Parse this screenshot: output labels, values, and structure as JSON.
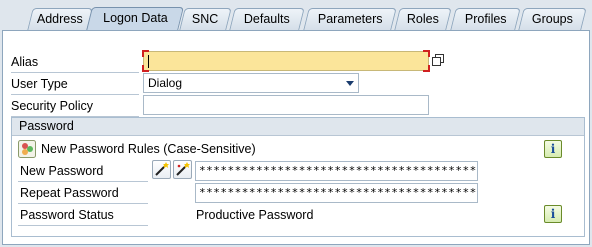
{
  "tabs": [
    {
      "label": "Address",
      "active": false
    },
    {
      "label": "Logon Data",
      "active": true
    },
    {
      "label": "SNC",
      "active": false
    },
    {
      "label": "Defaults",
      "active": false
    },
    {
      "label": "Parameters",
      "active": false
    },
    {
      "label": "Roles",
      "active": false
    },
    {
      "label": "Profiles",
      "active": false
    },
    {
      "label": "Groups",
      "active": false
    }
  ],
  "form": {
    "alias_label": "Alias",
    "alias_value": "",
    "user_type_label": "User Type",
    "user_type_value": "Dialog",
    "security_policy_label": "Security Policy",
    "security_policy_value": ""
  },
  "password_group": {
    "title": "Password",
    "rules_text": "New Password Rules (Case-Sensitive)",
    "new_password_label": "New Password",
    "new_password_value": "************************************************",
    "repeat_password_label": "Repeat Password",
    "repeat_password_value": "************************************************",
    "status_label": "Password Status",
    "status_value": "Productive Password"
  },
  "icons": {
    "copy": "copy-icon",
    "rules": "password-rules-icon",
    "info": "info-icon",
    "wand": "magic-wand-icon"
  },
  "colors": {
    "background": "#dfe6ed",
    "alias_field": "#fbe59a",
    "tab_border": "#8ea6bd",
    "required_marker": "#d02020"
  }
}
